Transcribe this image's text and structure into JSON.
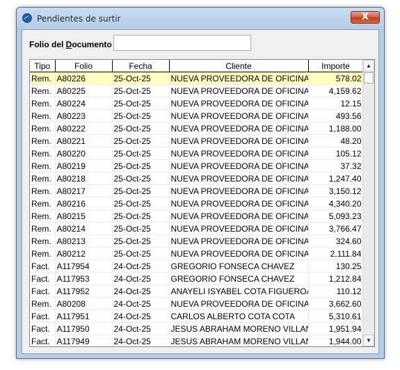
{
  "window": {
    "title": "Pendientes de surtir",
    "close_label": "X"
  },
  "folio": {
    "label_pre": "Folio del ",
    "label_mnemonic": "D",
    "label_post": "ocumento",
    "value": ""
  },
  "table": {
    "columns": [
      "Tipo",
      "Folio",
      "Fecha",
      "Cliente",
      "Importe"
    ],
    "rows": [
      [
        "Rem.",
        "A80226",
        "25-Oct-25",
        "NUEVA PROVEEDORA DE OFICINA",
        "578.02"
      ],
      [
        "Rem.",
        "A80225",
        "25-Oct-25",
        "NUEVA PROVEEDORA DE OFICINA",
        "4,159.62"
      ],
      [
        "Rem.",
        "A80224",
        "25-Oct-25",
        "NUEVA PROVEEDORA DE OFICINA",
        "12.15"
      ],
      [
        "Rem.",
        "A80223",
        "25-Oct-25",
        "NUEVA PROVEEDORA DE OFICINA",
        "493.56"
      ],
      [
        "Rem.",
        "A80222",
        "25-Oct-25",
        "NUEVA PROVEEDORA DE OFICINA",
        "1,188.00"
      ],
      [
        "Rem.",
        "A80221",
        "25-Oct-25",
        "NUEVA PROVEEDORA DE OFICINA",
        "48.20"
      ],
      [
        "Rem.",
        "A80220",
        "25-Oct-25",
        "NUEVA PROVEEDORA DE OFICINA",
        "105.12"
      ],
      [
        "Rem.",
        "A80219",
        "25-Oct-25",
        "NUEVA PROVEEDORA DE OFICINA",
        "37.32"
      ],
      [
        "Rem.",
        "A80218",
        "25-Oct-25",
        "NUEVA PROVEEDORA DE OFICINA",
        "1,247.40"
      ],
      [
        "Rem.",
        "A80217",
        "25-Oct-25",
        "NUEVA PROVEEDORA DE OFICINA",
        "3,150.12"
      ],
      [
        "Rem.",
        "A80216",
        "25-Oct-25",
        "NUEVA PROVEEDORA DE OFICINA",
        "4,340.20"
      ],
      [
        "Rem.",
        "A80215",
        "25-Oct-25",
        "NUEVA PROVEEDORA DE OFICINA",
        "5,093.23"
      ],
      [
        "Rem.",
        "A80214",
        "25-Oct-25",
        "NUEVA PROVEEDORA DE OFICINA",
        "3,766.47"
      ],
      [
        "Rem.",
        "A80213",
        "25-Oct-25",
        "NUEVA PROVEEDORA DE OFICINA",
        "324.60"
      ],
      [
        "Rem.",
        "A80212",
        "25-Oct-25",
        "NUEVA PROVEEDORA DE OFICINA",
        "2,111.84"
      ],
      [
        "Fact.",
        "A117954",
        "24-Oct-25",
        "GREGORIO FONSECA CHAVEZ",
        "130.25"
      ],
      [
        "Fact.",
        "A117953",
        "24-Oct-25",
        "GREGORIO FONSECA CHAVEZ",
        "1,212.84"
      ],
      [
        "Fact.",
        "A117952",
        "24-Oct-25",
        "ANAYELI ISYABEL COTA FIGUEROA",
        "110.12"
      ],
      [
        "Rem.",
        "A80208",
        "24-Oct-25",
        "NUEVA PROVEEDORA DE OFICINA",
        "3,662.60"
      ],
      [
        "Fact.",
        "A117951",
        "24-Oct-25",
        "CARLOS ALBERTO COTA COTA",
        "5,310.61"
      ],
      [
        "Fact.",
        "A117950",
        "24-Oct-25",
        "JESUS ABRAHAM MORENO VILLAN",
        "1,951.94"
      ],
      [
        "Fact.",
        "A117949",
        "24-Oct-25",
        "JESUS ABRAHAM MORENO VILLAN",
        "1,944.00"
      ]
    ],
    "selected_row": 0
  },
  "icons": {
    "app": "app-globe-icon",
    "scroll_up": "scroll-up-arrow-icon",
    "scroll_down": "scroll-down-arrow-icon"
  },
  "colors": {
    "selected_row": "#ffffc0",
    "close_button": "#c0391f"
  }
}
